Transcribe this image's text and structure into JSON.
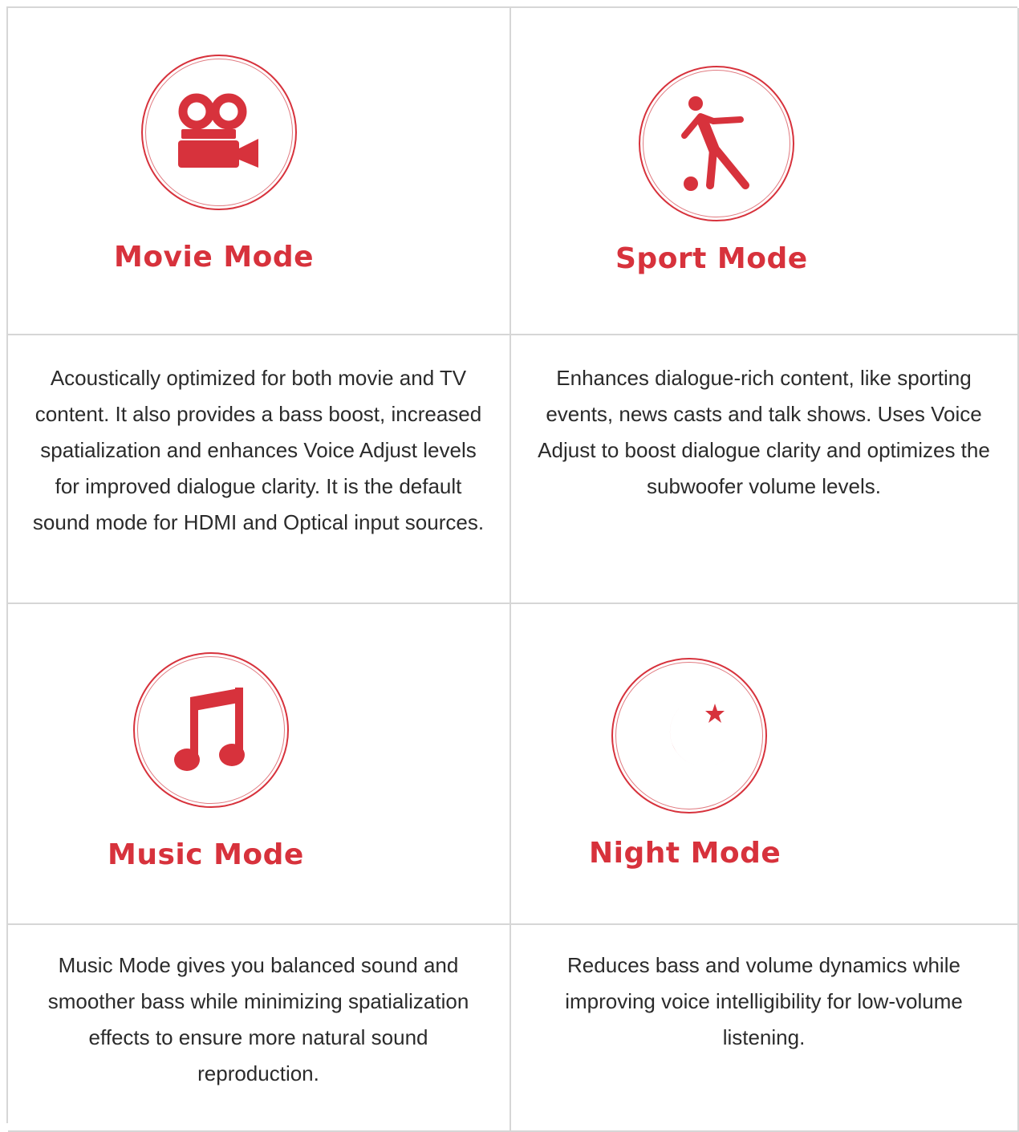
{
  "accent_color": "#d7323c",
  "modes": [
    {
      "title": "Movie Mode",
      "icon": "movie-camera-icon",
      "description": "Acoustically optimized for both movie and TV content. It also provides a bass boost, increased spatialization and enhances Voice Adjust levels for improved dialogue clarity. It is the default sound mode for HDMI and Optical input sources."
    },
    {
      "title": "Sport Mode",
      "icon": "soccer-player-icon",
      "description": "Enhances dialogue-rich content, like sporting events, news casts and talk shows. Uses Voice Adjust to boost dialogue clarity and optimizes the subwoofer volume levels."
    },
    {
      "title": "Music Mode",
      "icon": "music-note-icon",
      "description": "Music Mode gives you balanced sound and smoother bass while minimizing spatialization effects to ensure more natural sound reproduction."
    },
    {
      "title": "Night Mode",
      "icon": "moon-star-icon",
      "description": "Reduces bass and volume dynamics while improving voice intelligibility for low-volume listening."
    }
  ]
}
